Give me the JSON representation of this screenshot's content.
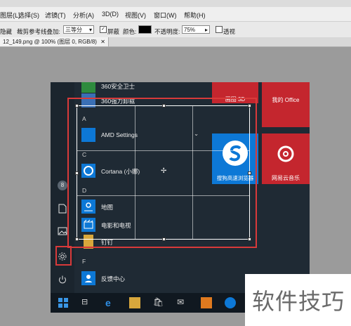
{
  "menubar": {
    "items": [
      "图层(L)",
      "选择(S)",
      "滤镜(T)",
      "分析(A)",
      "3D(D)",
      "视图(V)",
      "窗口(W)",
      "帮助(H)"
    ]
  },
  "options": {
    "hide_label": "隐藏",
    "overlay_label": "裁剪参考线叠加:",
    "overlay_value": "三等分",
    "shield_label": "屏蔽",
    "color_label": "颜色:",
    "opacity_label": "不透明度:",
    "opacity_value": "75%",
    "perspective_label": "透视",
    "shield_checked": "✓"
  },
  "document": {
    "tab_title": "12_149.png @ 100% (图层 0, RGB/8)"
  },
  "startmenu": {
    "top_items": [
      "360安全卫士",
      "360强力卸载"
    ],
    "groups": [
      {
        "letter": "A",
        "apps": [
          "AMD Settings"
        ]
      },
      {
        "letter": "C",
        "apps": [
          "Cortana (小娜)"
        ]
      },
      {
        "letter": "D",
        "apps": [
          "地图",
          "电影和电视",
          "钉钉"
        ]
      },
      {
        "letter": "F",
        "apps": [
          "反馈中心"
        ]
      }
    ],
    "user_initial": "8",
    "tiles": {
      "top_left": "画图 3D",
      "office": "我的 Office",
      "sogou": "搜狗高速浏览器",
      "netease": "网易云音乐"
    }
  },
  "colors": {
    "annotation_red": "#d83a3a",
    "tile_blue": "#0d78d6",
    "tile_red": "#c4262e",
    "startmenu_bg": "#1f2a34"
  },
  "watermark": {
    "text": "软件技巧"
  }
}
